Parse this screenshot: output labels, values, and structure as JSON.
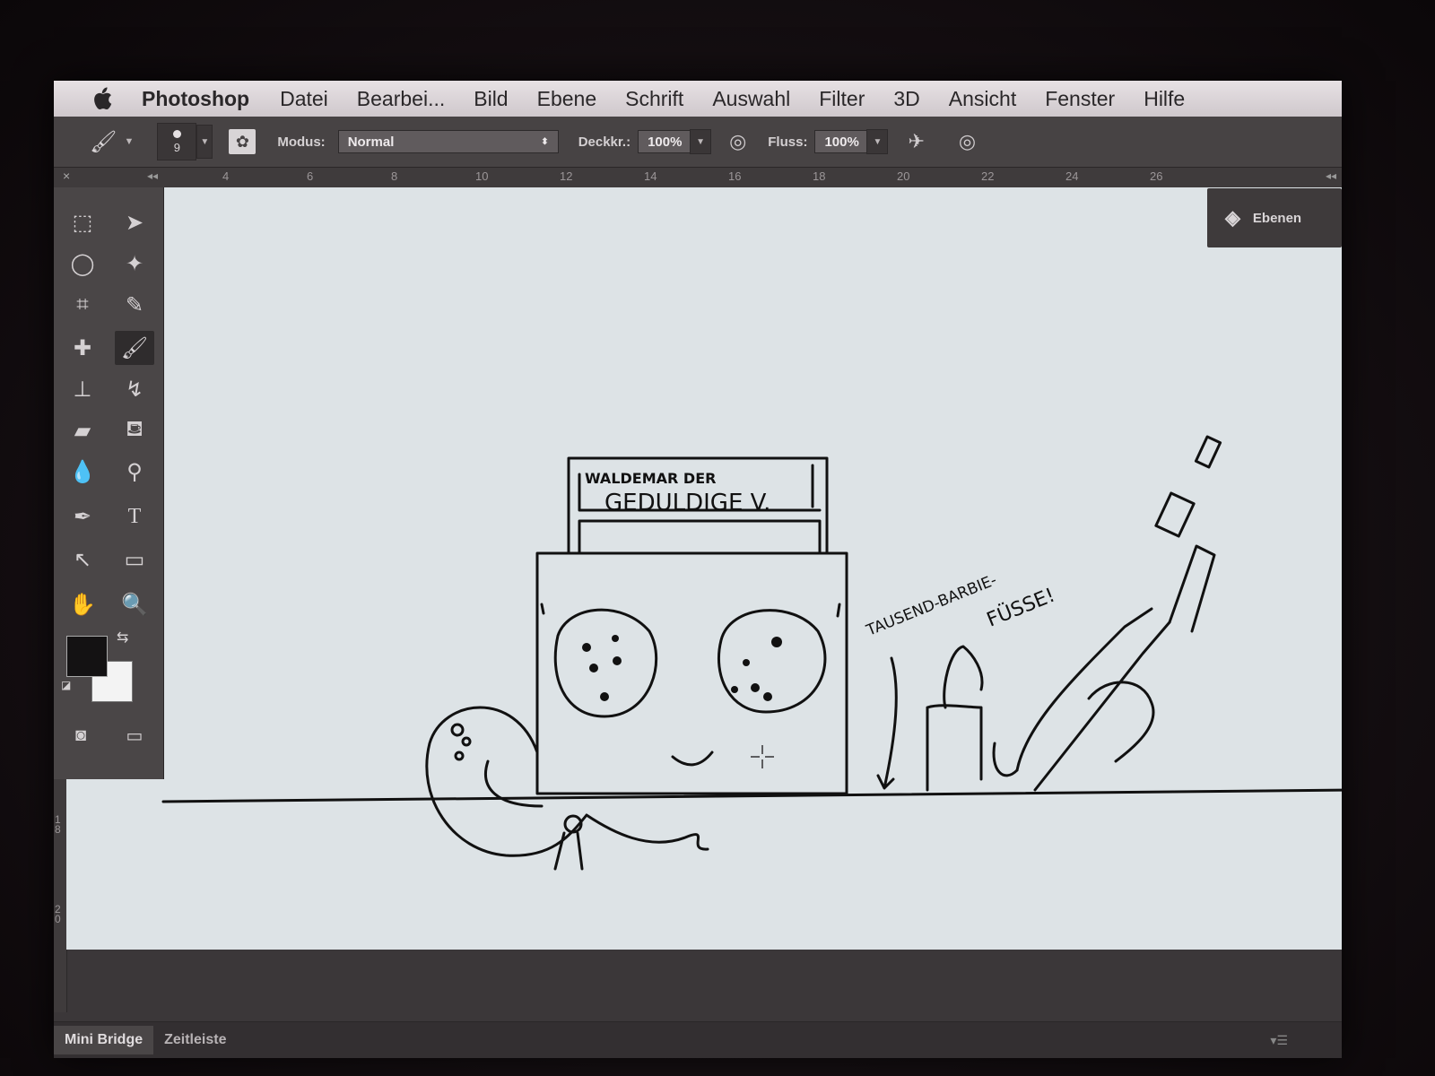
{
  "menubar": {
    "apple_icon": "apple-logo",
    "app_name": "Photoshop",
    "items": [
      "Datei",
      "Bearbei...",
      "Bild",
      "Ebene",
      "Schrift",
      "Auswahl",
      "Filter",
      "3D",
      "Ansicht",
      "Fenster",
      "Hilfe"
    ]
  },
  "options": {
    "brush_size": "9",
    "mode_label": "Modus:",
    "mode_value": "Normal",
    "opacity_label": "Deckkr.:",
    "opacity_value": "100%",
    "flow_label": "Fluss:",
    "flow_value": "100%"
  },
  "ruler_h": [
    "4",
    "6",
    "8",
    "10",
    "12",
    "14",
    "16",
    "18",
    "20",
    "22",
    "24",
    "26"
  ],
  "ruler_v": [
    "18",
    "20"
  ],
  "layers_tab": {
    "label": "Ebenen",
    "icon": "layers-icon"
  },
  "drawing": {
    "sign_line1": "WALDEMAR DER",
    "sign_line2": "GEDULDIGE V.",
    "caption_line1": "TAUSEND-BARBIE-",
    "caption_line2": "FÜSSE!"
  },
  "bottom_panel": {
    "tabs": [
      "Mini Bridge",
      "Zeitleiste"
    ]
  },
  "colors": {
    "foreground": "#141213",
    "background": "#f3f3f3"
  }
}
